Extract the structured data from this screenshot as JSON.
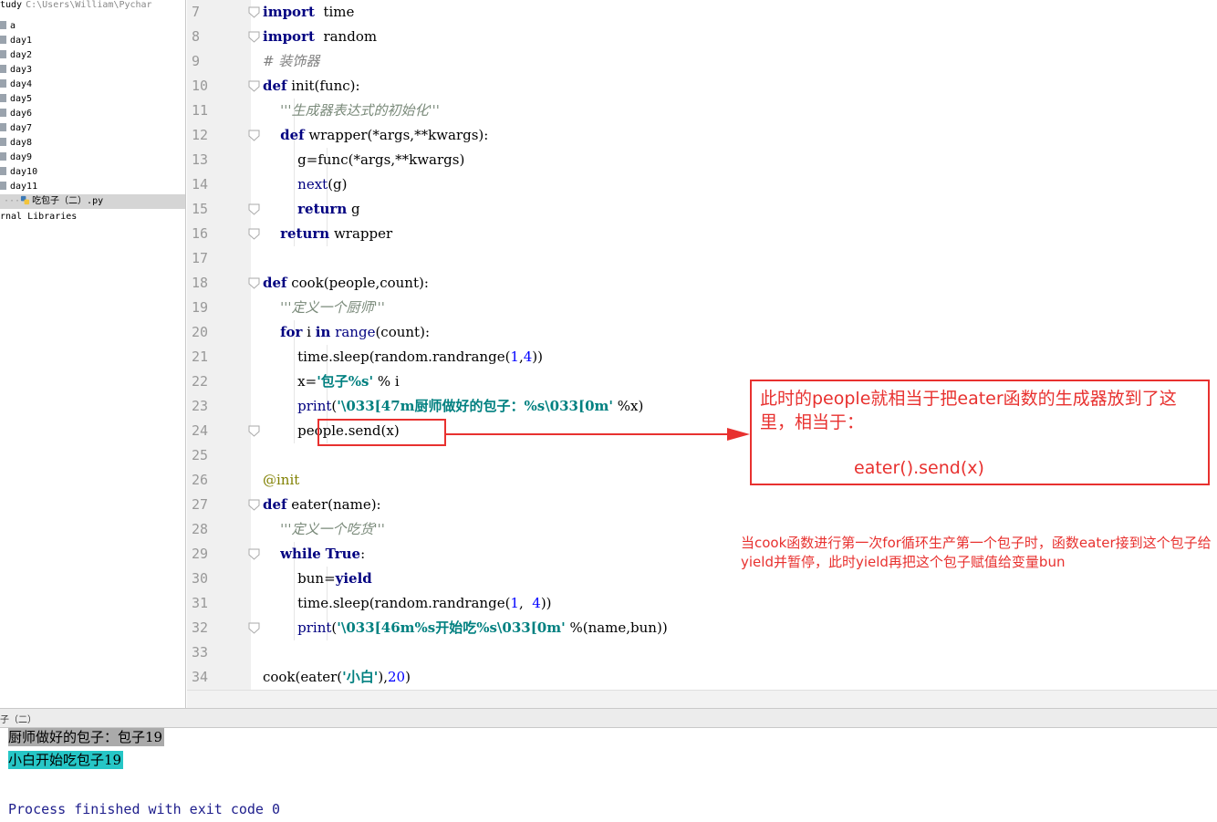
{
  "sidebar": {
    "root_label": "tudy",
    "root_path": "C:\\Users\\William\\Pychar",
    "folders": [
      "a",
      "day1",
      "day2",
      "day3",
      "day4",
      "day5",
      "day6",
      "day7",
      "day8",
      "day9",
      "day10",
      "day11"
    ],
    "selected_file": "吃包子（二）.py",
    "external_libraries": "rnal Libraries",
    "folder_icon": "folder-icon",
    "python_file_icon": "python-file-icon"
  },
  "editor": {
    "lines": [
      {
        "n": "7",
        "parts": [
          [
            "kw",
            "import"
          ],
          [
            "",
            "  time"
          ]
        ]
      },
      {
        "n": "8",
        "parts": [
          [
            "kw",
            "import"
          ],
          [
            "",
            "  random"
          ]
        ]
      },
      {
        "n": "9",
        "parts": [
          [
            "cmt",
            "# 装饰器"
          ]
        ]
      },
      {
        "n": "10",
        "parts": [
          [
            "kw",
            "def"
          ],
          [
            "",
            " init(func):"
          ]
        ]
      },
      {
        "n": "11",
        "parts": [
          [
            "",
            "    "
          ],
          [
            "doc",
            "'''生成器表达式的初始化'''"
          ]
        ]
      },
      {
        "n": "12",
        "parts": [
          [
            "",
            "    "
          ],
          [
            "kw",
            "def"
          ],
          [
            "",
            " wrapper(*args,**kwargs):"
          ]
        ]
      },
      {
        "n": "13",
        "parts": [
          [
            "",
            "        g=func(*args,**kwargs)"
          ]
        ]
      },
      {
        "n": "14",
        "parts": [
          [
            "",
            "        "
          ],
          [
            "bi",
            "next"
          ],
          [
            "",
            "(g)"
          ]
        ]
      },
      {
        "n": "15",
        "parts": [
          [
            "",
            "        "
          ],
          [
            "kw",
            "return"
          ],
          [
            "",
            " g"
          ]
        ]
      },
      {
        "n": "16",
        "parts": [
          [
            "",
            "    "
          ],
          [
            "kw",
            "return"
          ],
          [
            "",
            " wrapper"
          ]
        ]
      },
      {
        "n": "17",
        "parts": [
          [
            "",
            ""
          ]
        ]
      },
      {
        "n": "18",
        "parts": [
          [
            "kw",
            "def"
          ],
          [
            "",
            " cook(people,count):"
          ]
        ]
      },
      {
        "n": "19",
        "parts": [
          [
            "",
            "    "
          ],
          [
            "doc",
            "'''定义一个厨师'''"
          ]
        ]
      },
      {
        "n": "20",
        "parts": [
          [
            "",
            "    "
          ],
          [
            "kw",
            "for"
          ],
          [
            "",
            " i "
          ],
          [
            "kw",
            "in"
          ],
          [
            "",
            " "
          ],
          [
            "bi",
            "range"
          ],
          [
            "",
            "(count):"
          ]
        ]
      },
      {
        "n": "21",
        "parts": [
          [
            "",
            "        time.sleep(random.randrange("
          ],
          [
            "num",
            "1"
          ],
          [
            "",
            ","
          ],
          [
            "num",
            "4"
          ],
          [
            "",
            "))"
          ]
        ]
      },
      {
        "n": "22",
        "parts": [
          [
            "",
            "        x="
          ],
          [
            "str",
            "'包子%s'"
          ],
          [
            "",
            " % i"
          ]
        ]
      },
      {
        "n": "23",
        "parts": [
          [
            "",
            "        "
          ],
          [
            "bi",
            "print"
          ],
          [
            "",
            "("
          ],
          [
            "str",
            "'\\033[47m厨师做好的包子：%s\\033[0m'"
          ],
          [
            "",
            " %x)"
          ]
        ]
      },
      {
        "n": "24",
        "parts": [
          [
            "",
            "        people.send(x)"
          ]
        ]
      },
      {
        "n": "25",
        "parts": [
          [
            "",
            ""
          ]
        ]
      },
      {
        "n": "26",
        "parts": [
          [
            "dec",
            "@init"
          ]
        ]
      },
      {
        "n": "27",
        "parts": [
          [
            "kw",
            "def"
          ],
          [
            "",
            " eater(name):"
          ]
        ]
      },
      {
        "n": "28",
        "parts": [
          [
            "",
            "    "
          ],
          [
            "doc",
            "'''定义一个吃货'''"
          ]
        ]
      },
      {
        "n": "29",
        "parts": [
          [
            "",
            "    "
          ],
          [
            "kw",
            "while"
          ],
          [
            "",
            " "
          ],
          [
            "kw",
            "True"
          ],
          [
            "",
            ":"
          ]
        ]
      },
      {
        "n": "30",
        "parts": [
          [
            "",
            "        bun="
          ],
          [
            "kw",
            "yield"
          ]
        ]
      },
      {
        "n": "31",
        "parts": [
          [
            "",
            "        time.sleep(random.randrange("
          ],
          [
            "num",
            "1"
          ],
          [
            "",
            ",  "
          ],
          [
            "num",
            "4"
          ],
          [
            "",
            "))"
          ]
        ]
      },
      {
        "n": "32",
        "parts": [
          [
            "",
            "        "
          ],
          [
            "bi",
            "print"
          ],
          [
            "",
            "("
          ],
          [
            "str",
            "'\\033[46m%s开始吃%s\\033[0m'"
          ],
          [
            "",
            " %(name,bun))"
          ]
        ]
      },
      {
        "n": "33",
        "parts": [
          [
            "",
            ""
          ]
        ]
      },
      {
        "n": "34",
        "parts": [
          [
            "",
            "cook(eater("
          ],
          [
            "str",
            "'小白'"
          ],
          [
            "",
            "),"
          ],
          [
            "num",
            "20"
          ],
          [
            "",
            ")"
          ]
        ]
      }
    ],
    "fold_lines": [
      "7",
      "8",
      "10",
      "12",
      "15",
      "16",
      "18",
      "24",
      "27",
      "29",
      "32"
    ]
  },
  "annotations": {
    "note_text": "此时的people就相当于把eater函数的生成器放到了这里，相当于：",
    "note_code": "eater().send(x)",
    "note2": "当cook函数进行第一次for循环生产第一个包子时，函数eater接到这个包子给yield并暂停，此时yield再把这个包子赋值给变量bun",
    "accent_color": "#e8312f"
  },
  "run": {
    "tab_label": "子（二）",
    "output_lines": [
      "厨师做好的包子：包子19",
      "小白开始吃包子19",
      "Process finished with exit code 0"
    ],
    "gray_bg": "#aaaaaa",
    "cyan_bg": "#26c6c6"
  }
}
